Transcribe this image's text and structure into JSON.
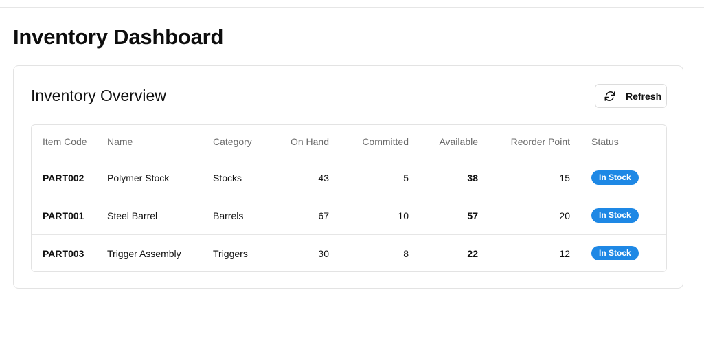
{
  "page": {
    "title": "Inventory Dashboard"
  },
  "card": {
    "title": "Inventory Overview",
    "refresh_label": "Refresh",
    "refresh_icon": "refresh-icon"
  },
  "table": {
    "headers": [
      "Item Code",
      "Name",
      "Category",
      "On Hand",
      "Committed",
      "Available",
      "Reorder Point",
      "Status"
    ],
    "rows": [
      {
        "item_code": "PART002",
        "name": "Polymer Stock",
        "category": "Stocks",
        "on_hand": "43",
        "committed": "5",
        "available": "38",
        "reorder_point": "15",
        "status": "In Stock"
      },
      {
        "item_code": "PART001",
        "name": "Steel Barrel",
        "category": "Barrels",
        "on_hand": "67",
        "committed": "10",
        "available": "57",
        "reorder_point": "20",
        "status": "In Stock"
      },
      {
        "item_code": "PART003",
        "name": "Trigger Assembly",
        "category": "Triggers",
        "on_hand": "30",
        "committed": "8",
        "available": "22",
        "reorder_point": "12",
        "status": "In Stock"
      }
    ]
  },
  "colors": {
    "status_badge": "#1e88e5",
    "text": "#111111",
    "muted_text": "#6b6b6b",
    "border": "#e3e3e3"
  }
}
